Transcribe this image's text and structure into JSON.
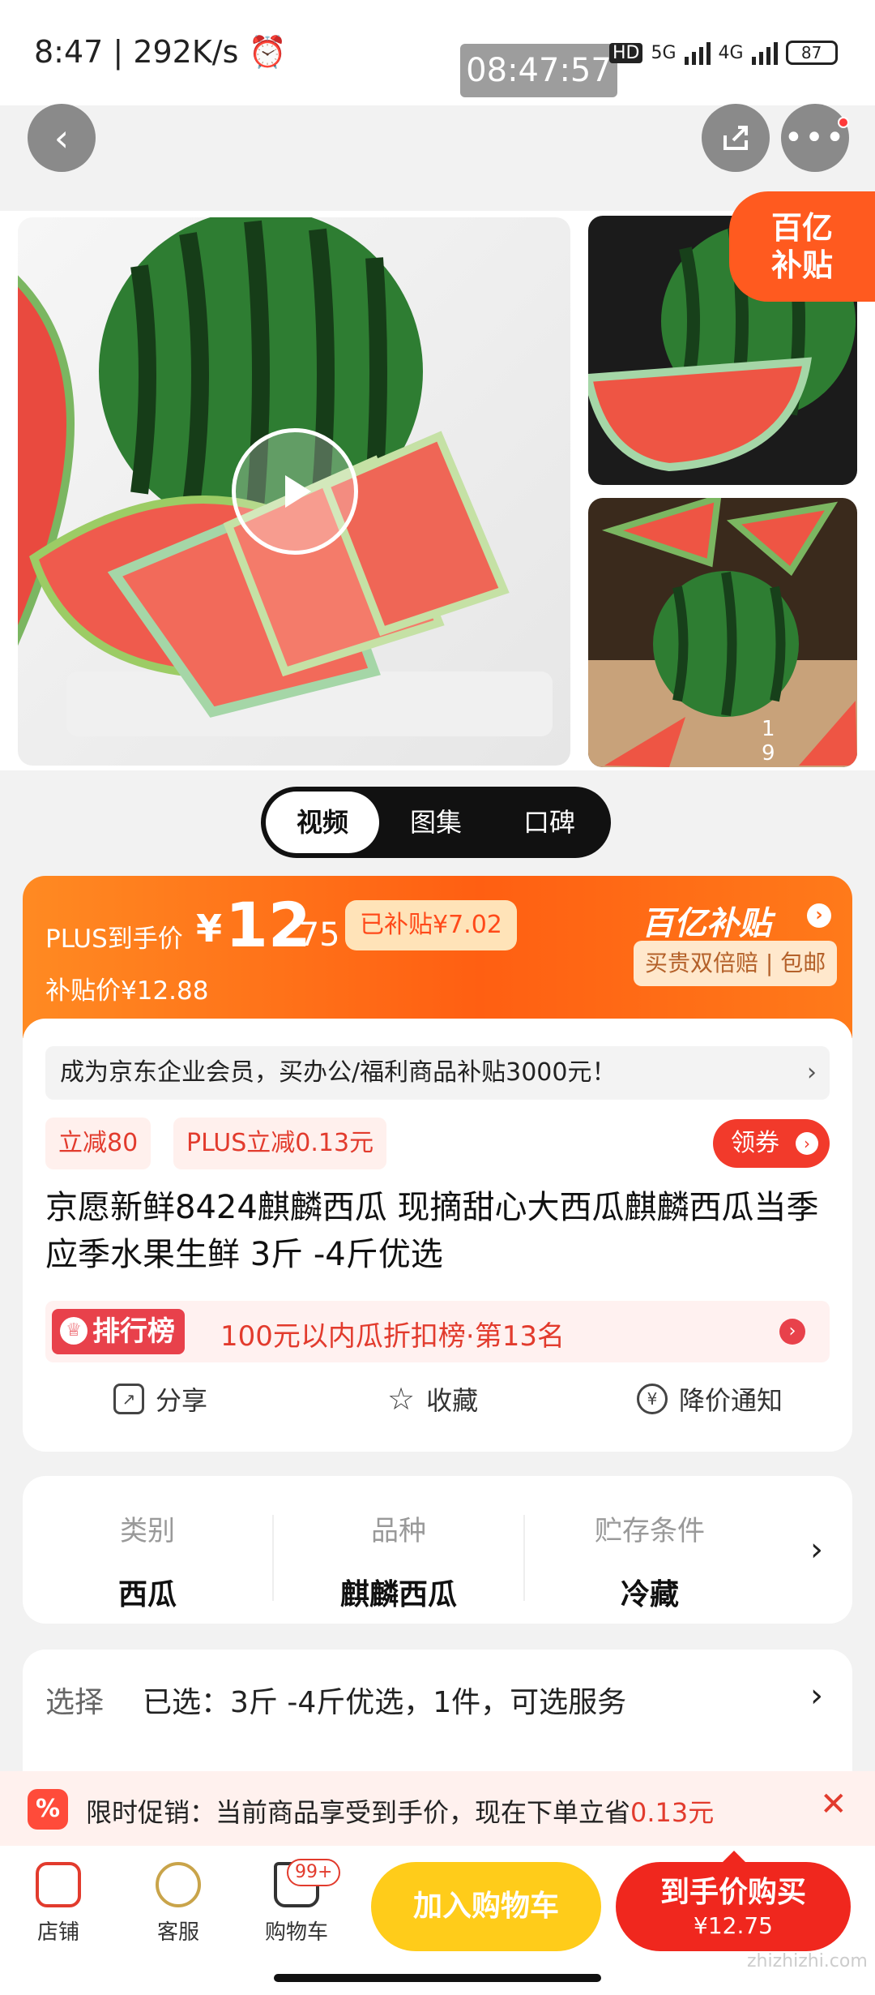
{
  "status": {
    "time": "8:47",
    "speed": "292K/s",
    "clock": "08:47:57",
    "hd": "HD",
    "net1": "5G",
    "net2": "4G",
    "battery": "87"
  },
  "gallery": {
    "counter": "1 9",
    "badge_line1": "百亿",
    "badge_line2": "补贴"
  },
  "media_tabs": [
    {
      "label": "视频"
    },
    {
      "label": "图集"
    },
    {
      "label": "口碑"
    }
  ],
  "price": {
    "plus_label": "PLUS到手价",
    "currency": "¥",
    "integer": "12",
    "decimal": ".75",
    "subsidized": "已补贴¥7.02",
    "subsidy_price": "补贴价¥12.88",
    "brand": "百亿补贴",
    "brand_tags": "买贵双倍赔 | 包邮"
  },
  "info": {
    "enterprise": "成为京东企业会员，买办公/福利商品补贴3000元！",
    "tags": [
      {
        "label": "立减80"
      },
      {
        "label": "PLUS立减0.13元"
      }
    ],
    "coupon": "领券",
    "title": "京愿新鲜8424麒麟西瓜 现摘甜心大西瓜麒麟西瓜当季应季水果生鲜 3斤 -4斤优选",
    "rank_badge": "排行榜",
    "rank_text": "100元以内瓜折扣榜·第13名",
    "actions": [
      {
        "label": "分享"
      },
      {
        "label": "收藏"
      },
      {
        "label": "降价通知"
      }
    ]
  },
  "attributes": [
    {
      "key": "类别",
      "value": "西瓜"
    },
    {
      "key": "品种",
      "value": "麒麟西瓜"
    },
    {
      "key": "贮存条件",
      "value": "冷藏"
    }
  ],
  "selection": {
    "key": "选择",
    "value": "已选：3斤 -4斤优选，1件，可选服务"
  },
  "promo": {
    "prefix": "限时促销：当前商品享受到手价，现在下单立省",
    "amount": "0.13元"
  },
  "bottom": {
    "shop": "店铺",
    "service": "客服",
    "cart": "购物车",
    "cart_count": "99+",
    "add_cart": "加入购物车",
    "buy_line1": "到手价购买",
    "buy_line2": "¥12.75"
  },
  "watermark": "zhizhizhi.com",
  "colors": {
    "accent_red": "#f0271e",
    "brand_orange": "#ff5f12",
    "cart_yellow": "#ffcc1a"
  }
}
